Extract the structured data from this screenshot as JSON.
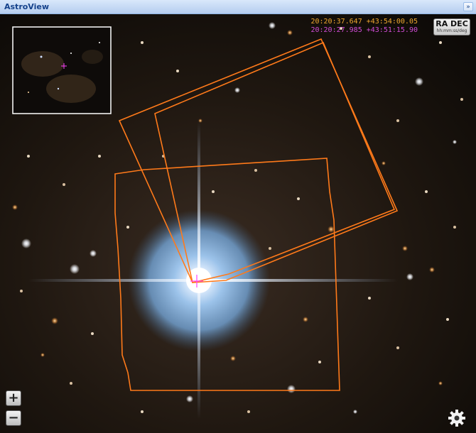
{
  "window": {
    "title": "AstroView",
    "collapse_symbol": "»"
  },
  "coordinates": {
    "cursor_ra": "20:20:37.647",
    "cursor_dec": "+43:54:00.05",
    "center_ra": "20:20:27.985",
    "center_dec": "+43:51:15.90",
    "cursor_color": "#f0a830",
    "center_color": "#d14cd6"
  },
  "coord_toggle": {
    "label": "RA DEC",
    "sublabel": "hh:mm:ss/deg"
  },
  "zoom": {
    "in_label": "+",
    "out_label": "−"
  },
  "overlay": {
    "footprint_color": "#ff7a1a",
    "crosshair_color": "#ff40ff"
  },
  "icons": {
    "settings": "gear-icon",
    "zoom_in": "plus-icon",
    "zoom_out": "minus-icon",
    "collapse": "double-chevron-right-icon"
  }
}
